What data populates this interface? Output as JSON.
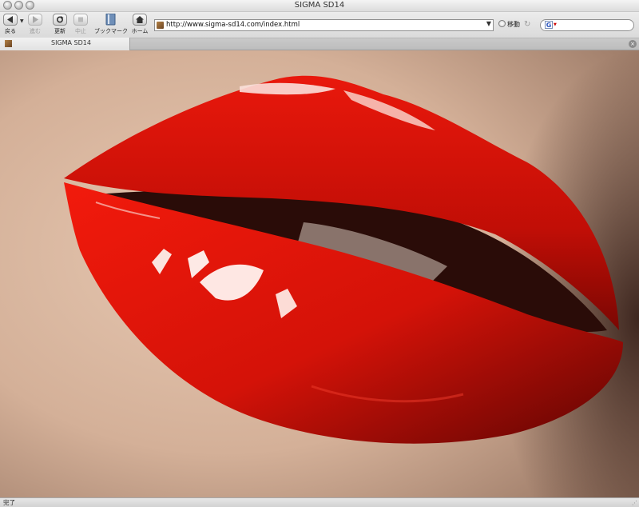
{
  "window": {
    "title": "SIGMA SD14"
  },
  "toolbar": {
    "back_label": "戻る",
    "forward_label": "進む",
    "reload_label": "更新",
    "stop_label": "中止",
    "bookmarks_label": "ブックマーク",
    "home_label": "ホーム"
  },
  "address": {
    "url": "http://www.sigma-sd14.com/index.html",
    "go_label": "移動"
  },
  "search": {
    "engine_icon": "G"
  },
  "tabs": [
    {
      "title": "SIGMA SD14",
      "active": true
    }
  ],
  "content": {
    "image_subject": "red-glossy-lips-photo"
  },
  "status": {
    "text": "完了"
  },
  "colors": {
    "lip_red": "#d41208",
    "skin": "#d9b79e",
    "toolbar": "#e0e0e0"
  }
}
